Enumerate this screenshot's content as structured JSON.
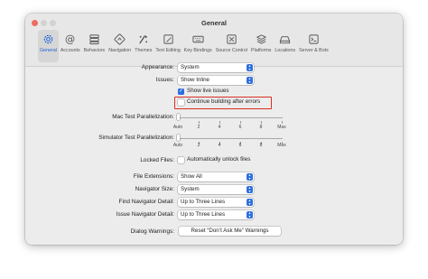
{
  "window": {
    "title": "General"
  },
  "toolbar": {
    "items": [
      {
        "label": "General",
        "icon": "gear-icon",
        "active": true
      },
      {
        "label": "Accounts",
        "icon": "at-icon"
      },
      {
        "label": "Behaviors",
        "icon": "behaviors-icon"
      },
      {
        "label": "Navigation",
        "icon": "navigation-icon"
      },
      {
        "label": "Themes",
        "icon": "themes-icon"
      },
      {
        "label": "Text Editing",
        "icon": "text-editing-icon"
      },
      {
        "label": "Key Bindings",
        "icon": "keyboard-icon"
      },
      {
        "label": "Source Control",
        "icon": "source-control-icon"
      },
      {
        "label": "Platforms",
        "icon": "platforms-icon"
      },
      {
        "label": "Locations",
        "icon": "locations-icon"
      },
      {
        "label": "Server & Bots",
        "icon": "server-icon"
      }
    ]
  },
  "settings": {
    "appearance": {
      "label": "Appearance:",
      "value": "System"
    },
    "issues": {
      "label": "Issues:",
      "value": "Show Inline"
    },
    "show_live_issues": {
      "label": "Show live issues",
      "checked": true
    },
    "continue_building": {
      "label": "Continue building after errors",
      "checked": false
    },
    "mac_test_parallelization": {
      "label": "Mac Test Parallelization:",
      "value": "Auto"
    },
    "simulator_test_parallelization": {
      "label": "Simulator Test Parallelization:",
      "value": "Auto"
    },
    "slider_ticks": [
      "Auto",
      "2",
      "4",
      "6",
      "8",
      "Max"
    ],
    "locked_files": {
      "label": "Locked Files:",
      "option": "Automatically unlock files",
      "checked": false
    },
    "file_extensions": {
      "label": "File Extensions:",
      "value": "Show All"
    },
    "navigator_size": {
      "label": "Navigator Size:",
      "value": "System"
    },
    "find_navigator_detail": {
      "label": "Find Navigator Detail:",
      "value": "Up to Three Lines"
    },
    "issue_navigator_detail": {
      "label": "Issue Navigator Detail:",
      "value": "Up to Three Lines"
    },
    "dialog_warnings": {
      "label": "Dialog Warnings:",
      "button": "Reset “Don’t Ask Me” Warnings"
    }
  },
  "colors": {
    "accent": "#2e6fe0",
    "highlight": "#d92d20",
    "close": "#ee6b60"
  }
}
